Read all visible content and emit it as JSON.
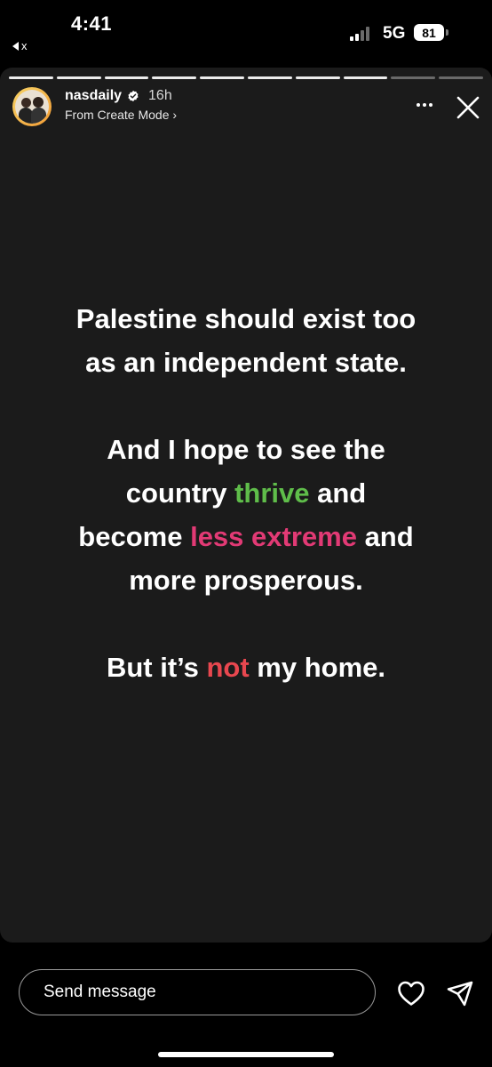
{
  "status_bar": {
    "time": "4:41",
    "back_label": "x",
    "network": "5G",
    "battery": "81"
  },
  "story": {
    "progress_total": 10,
    "progress_done": 8,
    "username": "nasdaily",
    "age": "16h",
    "subtitle": "From Create Mode ›",
    "text": {
      "p1": "Palestine should exist too as an independent state.",
      "p2_a": "And I hope to see the country ",
      "p2_thrive": "thrive",
      "p2_b": " and become ",
      "p2_less_extreme": "less extreme",
      "p2_c": " and more prosperous.",
      "p3_a": "But it’s ",
      "p3_not": "not",
      "p3_b": " my home."
    },
    "accent_colors": {
      "thrive": "#5fbd4a",
      "less_extreme": "#e23a75",
      "not": "#e8474f"
    }
  },
  "reply_bar": {
    "placeholder": "Send message"
  },
  "icons": [
    "back-triangle-icon",
    "signal-icon",
    "verified-icon",
    "more-icon",
    "close-icon",
    "heart-icon",
    "share-icon"
  ]
}
